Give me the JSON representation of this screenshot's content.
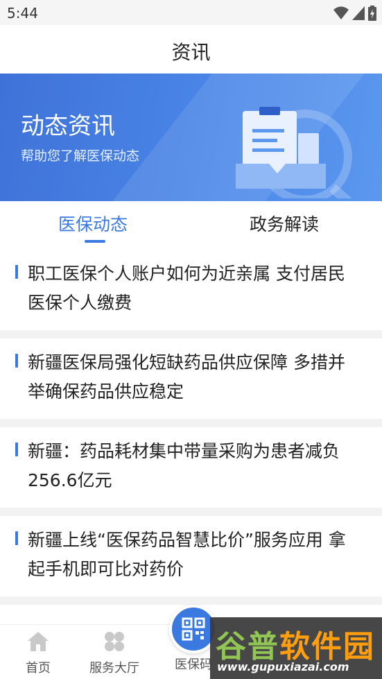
{
  "status_bar": {
    "time": "5:44"
  },
  "header": {
    "title": "资讯"
  },
  "banner": {
    "title": "动态资讯",
    "subtitle": "帮助您了解医保动态"
  },
  "tabs": [
    {
      "label": "医保动态",
      "active": true
    },
    {
      "label": "政务解读",
      "active": false
    }
  ],
  "news": [
    {
      "title": "职工医保个人账户如何为近亲属 支付居民医保个人缴费"
    },
    {
      "title": "新疆医保局强化短缺药品供应保障 多措并举确保药品供应稳定"
    },
    {
      "title": "新疆：药品耗材集中带量采购为患者减负256.6亿元"
    },
    {
      "title": "新疆上线“医保药品智慧比价”服务应用 拿起手机即可比对药价"
    }
  ],
  "bottom_nav": [
    {
      "label": "首页",
      "icon": "home-icon"
    },
    {
      "label": "服务大厅",
      "icon": "grid-icon"
    },
    {
      "label": "医保码",
      "icon": "qr-code-icon"
    }
  ],
  "watermark": {
    "logo_text": "谷普软件园",
    "url": "www.gupuxiazai.com"
  },
  "colors": {
    "accent": "#3a79e0",
    "banner": "#4a86e8",
    "separator": "#f2f2f2"
  }
}
